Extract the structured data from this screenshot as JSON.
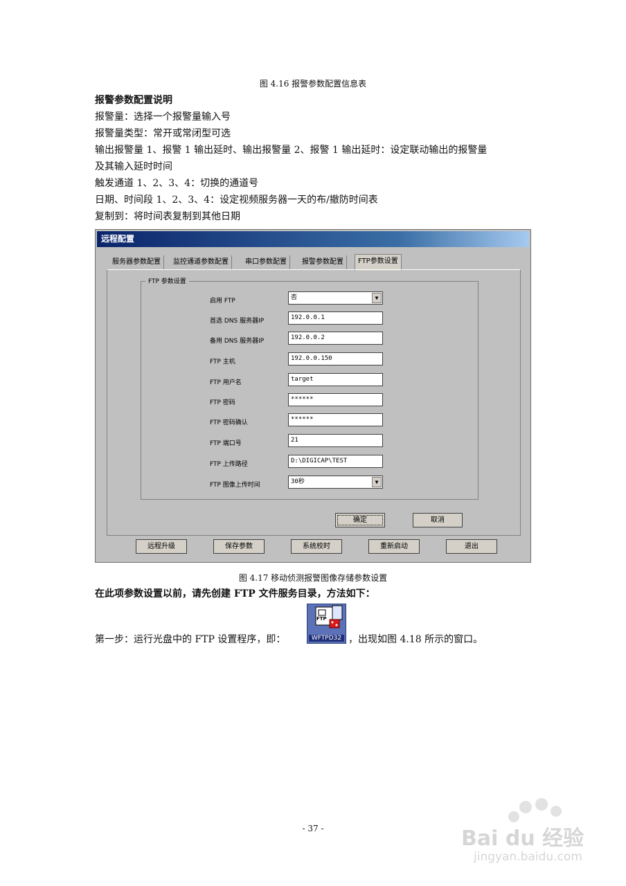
{
  "caption_top": "图 4.16  报警参数配置信息表",
  "section_title": "报警参数配置说明",
  "lines": [
    "报警量：选择一个报警量输入号",
    "报警量类型：常开或常闭型可选",
    "输出报警量 1、报警 1 输出延时、输出报警量 2、报警 1 输出延时：设定联动输出的报警量",
    "及其输入延时时间",
    "触发通道 1、2、3、4：切换的通道号",
    "日期、时间段 1、2、3、4：设定视频服务器一天的布/撤防时间表",
    "复制到：将时间表复制到其他日期"
  ],
  "dialog": {
    "title": "远程配置",
    "tabs": [
      "服务器参数配置",
      "监控通道参数配置",
      "串口参数配置",
      "报警参数配置",
      "FTP参数设置"
    ],
    "group_label": "FTP 参数设置",
    "fields": [
      {
        "label": "启用 FTP",
        "value": "否",
        "dropdown": true
      },
      {
        "label": "首选 DNS 服务器IP",
        "value": "192.0.0.1"
      },
      {
        "label": "备用 DNS 服务器IP",
        "value": "192.0.0.2"
      },
      {
        "label": "FTP 主机",
        "value": "192.0.0.150"
      },
      {
        "label": "FTP 用户名",
        "value": "target"
      },
      {
        "label": "FTP 密码",
        "value": "******"
      },
      {
        "label": "FTP 密码确认",
        "value": "******"
      },
      {
        "label": "FTP 端口号",
        "value": "21"
      },
      {
        "label": "FTP 上传路径",
        "value": "D:\\DIGICAP\\TEST"
      },
      {
        "label": "FTP 图像上传时间",
        "value": "30秒",
        "dropdown": true
      }
    ],
    "ok": "确定",
    "cancel": "取消",
    "bottom_buttons": [
      "远程升级",
      "保存参数",
      "系统校时",
      "重新启动",
      "退出"
    ]
  },
  "caption_mid": "图 4.17  移动侦测报警图像存储参数设置",
  "bold_line": "在此项参数设置以前，请先创建 FTP 文件服务目录，方法如下：",
  "step1_before": "第一步：运行光盘中的 FTP 设置程序，即：",
  "icon_label": "WFTPD32",
  "icon_ftp": "FTP",
  "step1_after": "，出现如图 4.18 所示的窗口。",
  "page_number": "- 37 -",
  "watermark_brand": "Bai du 经验",
  "watermark_url": "jingyan.baidu.com"
}
